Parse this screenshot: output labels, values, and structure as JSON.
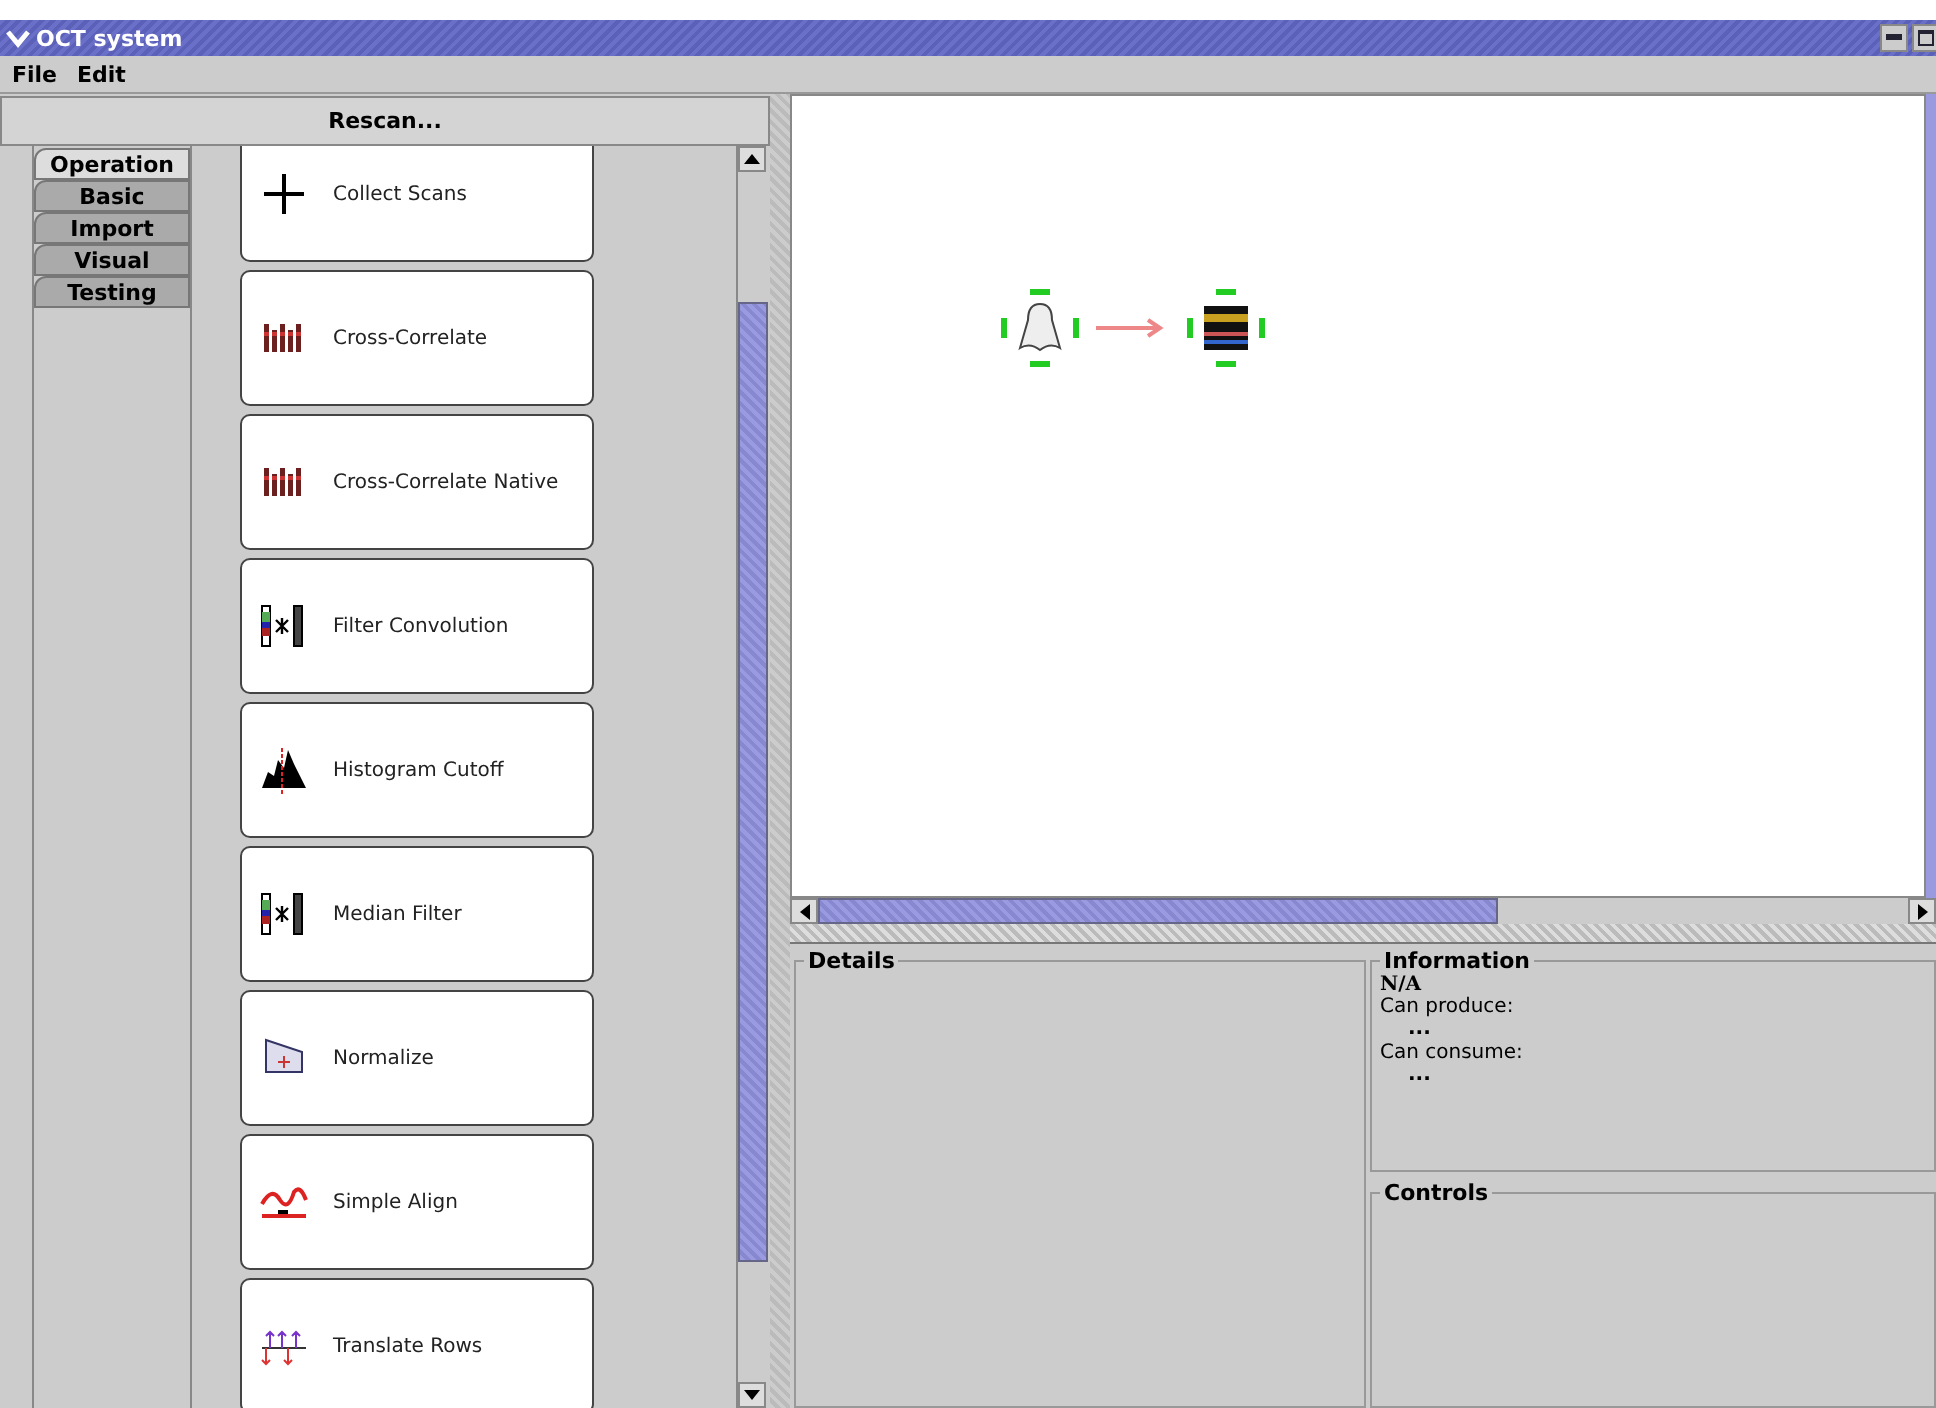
{
  "window": {
    "title": "OCT system"
  },
  "menu": [
    "File",
    "Edit"
  ],
  "rescan_button": "Rescan...",
  "tabs": [
    {
      "label": "Operation",
      "selected": true
    },
    {
      "label": "Basic",
      "selected": false
    },
    {
      "label": "Import",
      "selected": false
    },
    {
      "label": "Visual",
      "selected": false
    },
    {
      "label": "Testing",
      "selected": false
    }
  ],
  "tools": [
    {
      "label": "Collect Scans"
    },
    {
      "label": "Cross-Correlate"
    },
    {
      "label": "Cross-Correlate Native"
    },
    {
      "label": "Filter Convolution"
    },
    {
      "label": "Histogram Cutoff"
    },
    {
      "label": "Median Filter"
    },
    {
      "label": "Normalize"
    },
    {
      "label": "Simple Align"
    },
    {
      "label": "Translate Rows"
    }
  ],
  "canvas": {
    "nodes": [
      {
        "selected": true
      },
      {
        "selected": true
      }
    ]
  },
  "details": {
    "title": "Details"
  },
  "information": {
    "title": "Information",
    "heading": "N/A",
    "lines": [
      {
        "kind": "label",
        "text": "Can produce:"
      },
      {
        "kind": "value",
        "text": "..."
      },
      {
        "kind": "label",
        "text": "Can consume:"
      },
      {
        "kind": "value",
        "text": "..."
      }
    ]
  },
  "controls": {
    "title": "Controls"
  }
}
